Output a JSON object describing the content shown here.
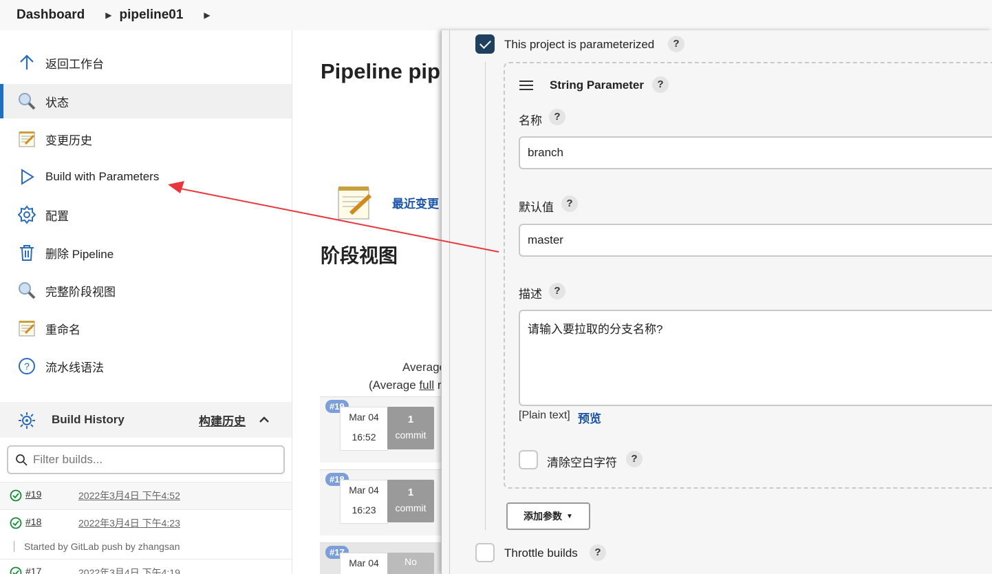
{
  "breadcrumb": {
    "items": [
      "Dashboard",
      "pipeline01"
    ]
  },
  "sidebar": {
    "tasks": [
      {
        "label": "返回工作台",
        "icon": "arrow-up-icon"
      },
      {
        "label": "状态",
        "icon": "magnifier-icon",
        "active": true
      },
      {
        "label": "变更历史",
        "icon": "notepad-icon"
      },
      {
        "label": "Build with Parameters",
        "icon": "play-icon"
      },
      {
        "label": "配置",
        "icon": "gear-icon"
      },
      {
        "label": "删除 Pipeline",
        "icon": "trash-icon"
      },
      {
        "label": "完整阶段视图",
        "icon": "magnifier-icon"
      },
      {
        "label": "重命名",
        "icon": "notepad-icon"
      },
      {
        "label": "流水线语法",
        "icon": "help-circle-icon"
      }
    ],
    "build_history": {
      "title": "Build History",
      "link": "构建历史",
      "search_placeholder": "Filter builds...",
      "rows": [
        {
          "num": "#19",
          "date": "2022年3月4日 下午4:52"
        },
        {
          "num": "#18",
          "date": "2022年3月4日 下午4:23",
          "cause": "Started by GitLab push by zhangsan"
        },
        {
          "num": "#17",
          "date": "2022年3月4日 下午4:19"
        }
      ]
    }
  },
  "main": {
    "title": "Pipeline pip",
    "recent_changes": "最近变更",
    "stage_view_title": "阶段视图",
    "average_line1": "Average",
    "average_line2_prefix": "(Average ",
    "average_line2_link": "full",
    "average_line2_suffix": " r",
    "stage_rows": [
      {
        "badge": "#19",
        "date": "Mar 04",
        "time": "16:52",
        "commit_count": "1",
        "commit_label": "commit"
      },
      {
        "badge": "#18",
        "date": "Mar 04",
        "time": "16:23",
        "commit_count": "1",
        "commit_label": "commit"
      },
      {
        "badge": "#17",
        "date": "Mar 04",
        "time": "",
        "commit_count": "No",
        "commit_label": ""
      }
    ]
  },
  "config": {
    "parameterized_label": "This project is parameterized",
    "parameterized_checked": true,
    "param_type": "String Parameter",
    "name_label": "名称",
    "name_value": "branch",
    "default_label": "默认值",
    "default_value": "master",
    "desc_label": "描述",
    "desc_value": "请输入要拉取的分支名称?",
    "plain_text": "[Plain text]",
    "preview": "预览",
    "trim_label": "清除空白字符",
    "trim_checked": false,
    "add_param_button": "添加参数",
    "throttle_label": "Throttle builds",
    "throttle_checked": false,
    "help_glyph": "?"
  },
  "colors": {
    "accent": "#1f6fc5",
    "annotation_arrow": "#e8383d",
    "checkbox_checked": "#1f3f5f",
    "link": "#1c55a8"
  }
}
